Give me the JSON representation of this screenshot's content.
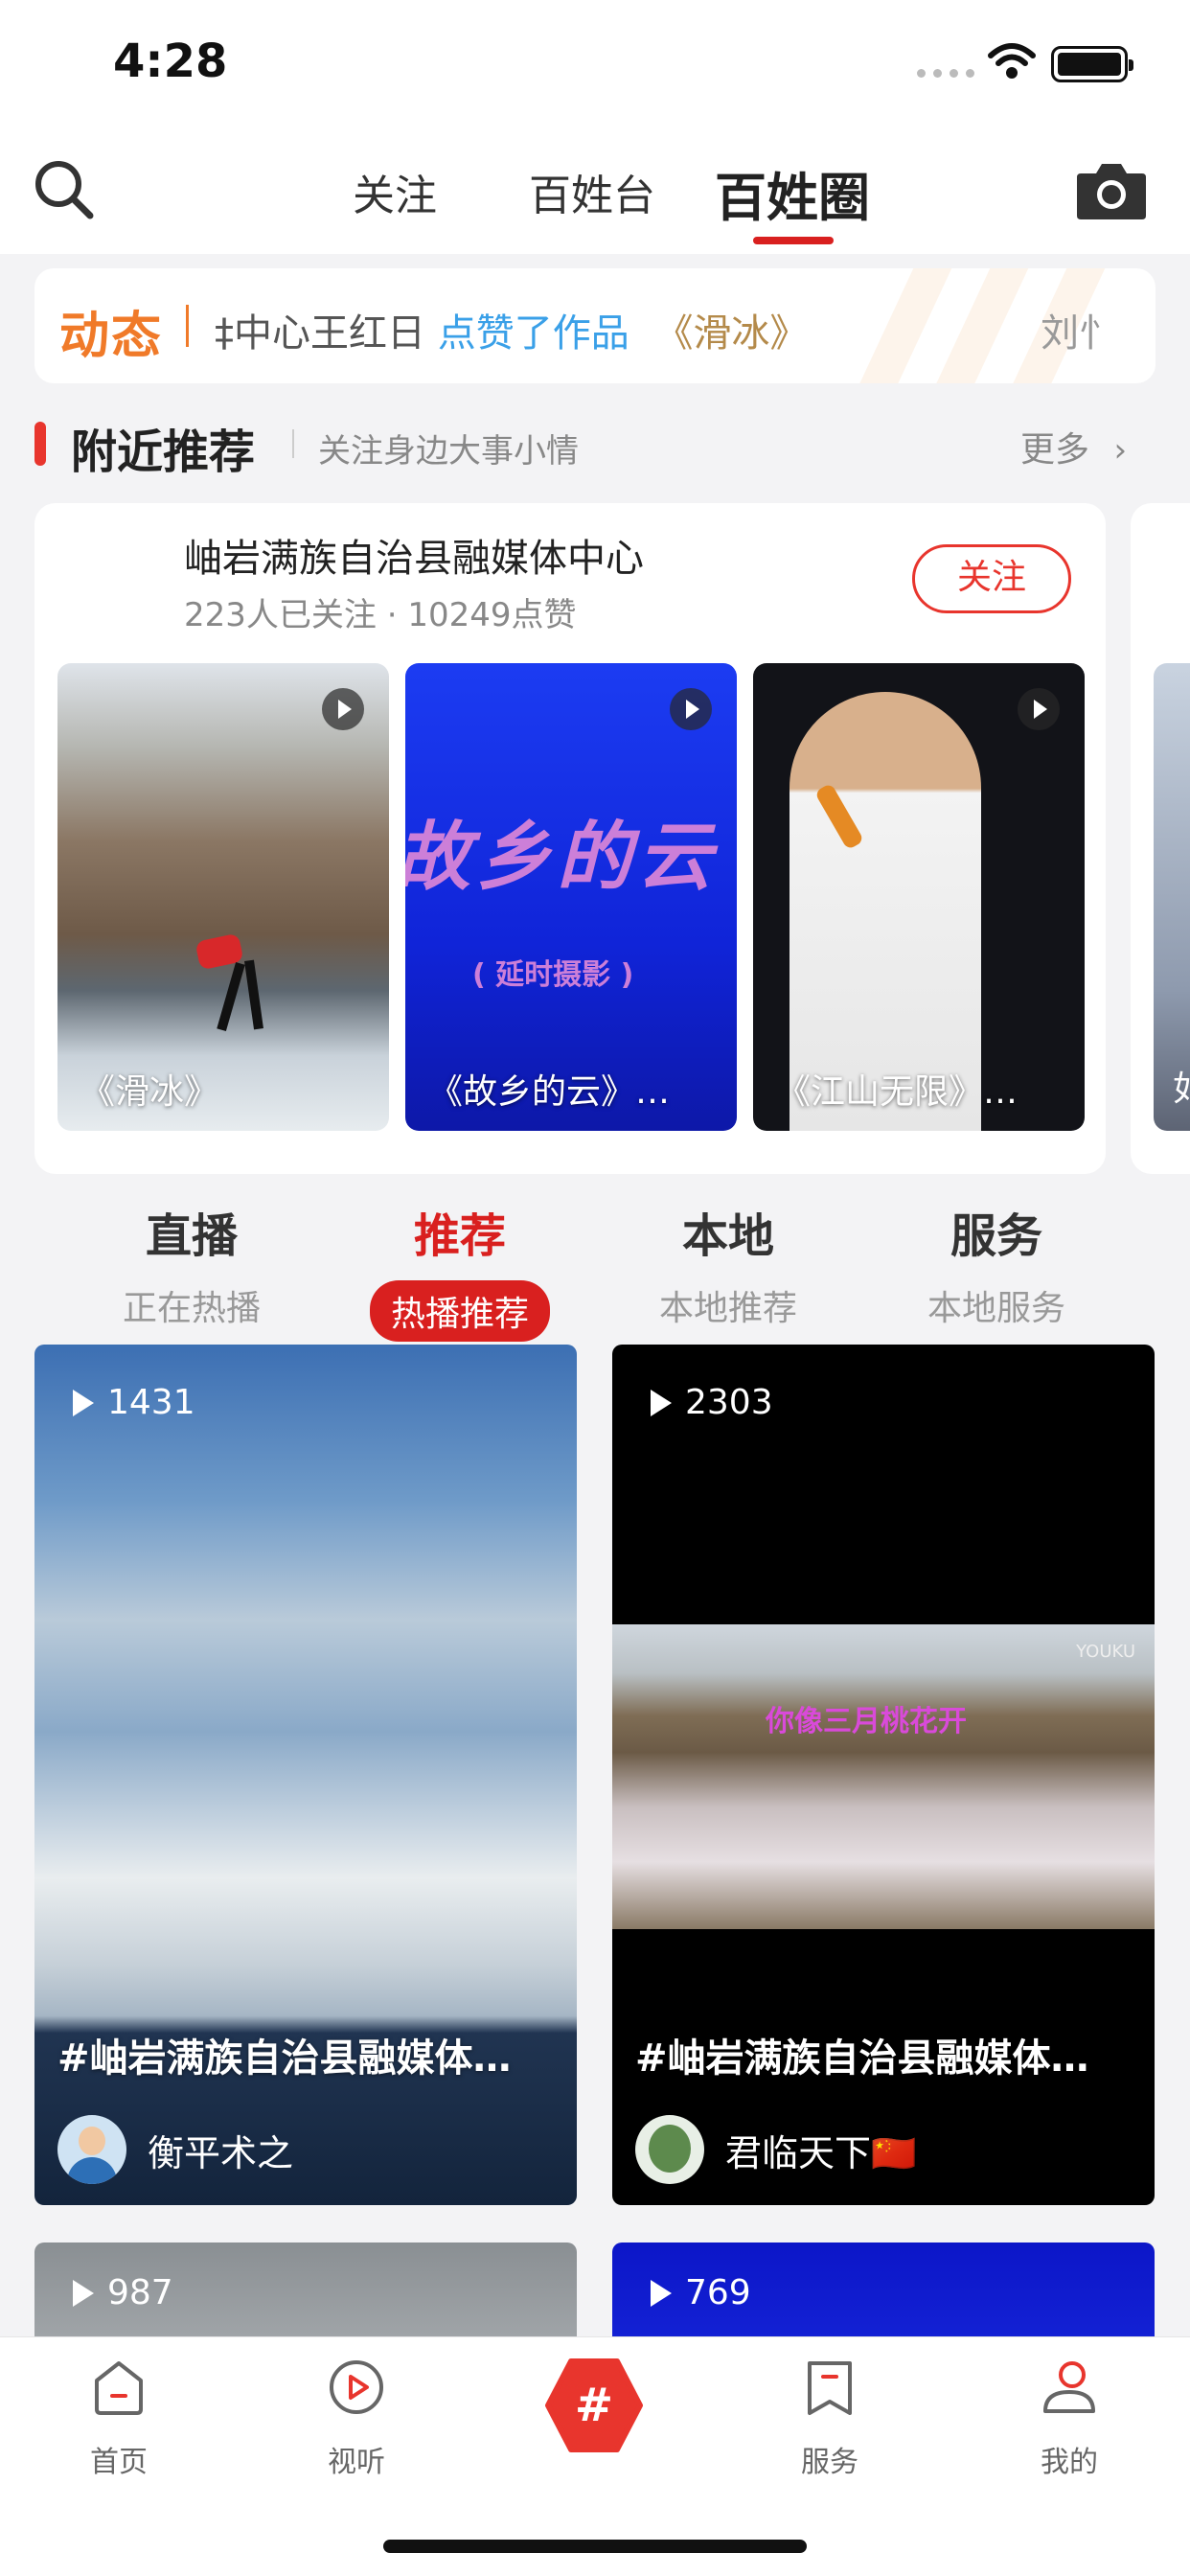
{
  "status_bar": {
    "time": "4:28"
  },
  "top_nav": {
    "tabs": [
      {
        "label": "关注"
      },
      {
        "label": "百姓台"
      },
      {
        "label": "百姓圈"
      }
    ],
    "active_tab": "百姓圈"
  },
  "ticker": {
    "label": "动态",
    "text_lead": "‡中心王红日",
    "text_action": "点赞了作品",
    "text_work": "《滑冰》",
    "text_next": "刘忄"
  },
  "nearby": {
    "title": "附近推荐",
    "subtitle": "关注身边大事小情",
    "more": "更多",
    "card": {
      "name": "岫岩满族自治县融媒体中心",
      "stats": "223人已关注 · 10249点赞",
      "follow_label": "关注",
      "videos": [
        {
          "caption": "《滑冰》"
        },
        {
          "caption": "《故乡的云》…"
        },
        {
          "caption": "《江山无限》…"
        }
      ],
      "peek_caption": "如"
    }
  },
  "categories": [
    {
      "title": "直播",
      "subtitle": "正在热播"
    },
    {
      "title": "推荐",
      "subtitle": "热播推荐"
    },
    {
      "title": "本地",
      "subtitle": "本地推荐"
    },
    {
      "title": "服务",
      "subtitle": "本地服务"
    }
  ],
  "active_category": "推荐",
  "feed": [
    {
      "plays": "1431",
      "title": "#岫岩满族自治县融媒体…",
      "user": "衡平术之"
    },
    {
      "plays": "2303",
      "title": "#岫岩满族自治县融媒体…",
      "user": "君临天下🇨🇳",
      "overlay_title": "你像三月桃花开",
      "watermark": "YOUKU"
    },
    {
      "plays": "987"
    },
    {
      "plays": "769"
    }
  ],
  "tab_bar": {
    "items": [
      {
        "label": "首页",
        "icon": "home-icon"
      },
      {
        "label": "视听",
        "icon": "play-circle-icon"
      },
      {
        "label": "",
        "icon": "hashtag-icon"
      },
      {
        "label": "服务",
        "icon": "bookmark-icon"
      },
      {
        "label": "我的",
        "icon": "profile-icon"
      }
    ]
  },
  "colors": {
    "accent": "#d9201f",
    "ticker": "#f07a29",
    "link": "#3aa0e8"
  }
}
